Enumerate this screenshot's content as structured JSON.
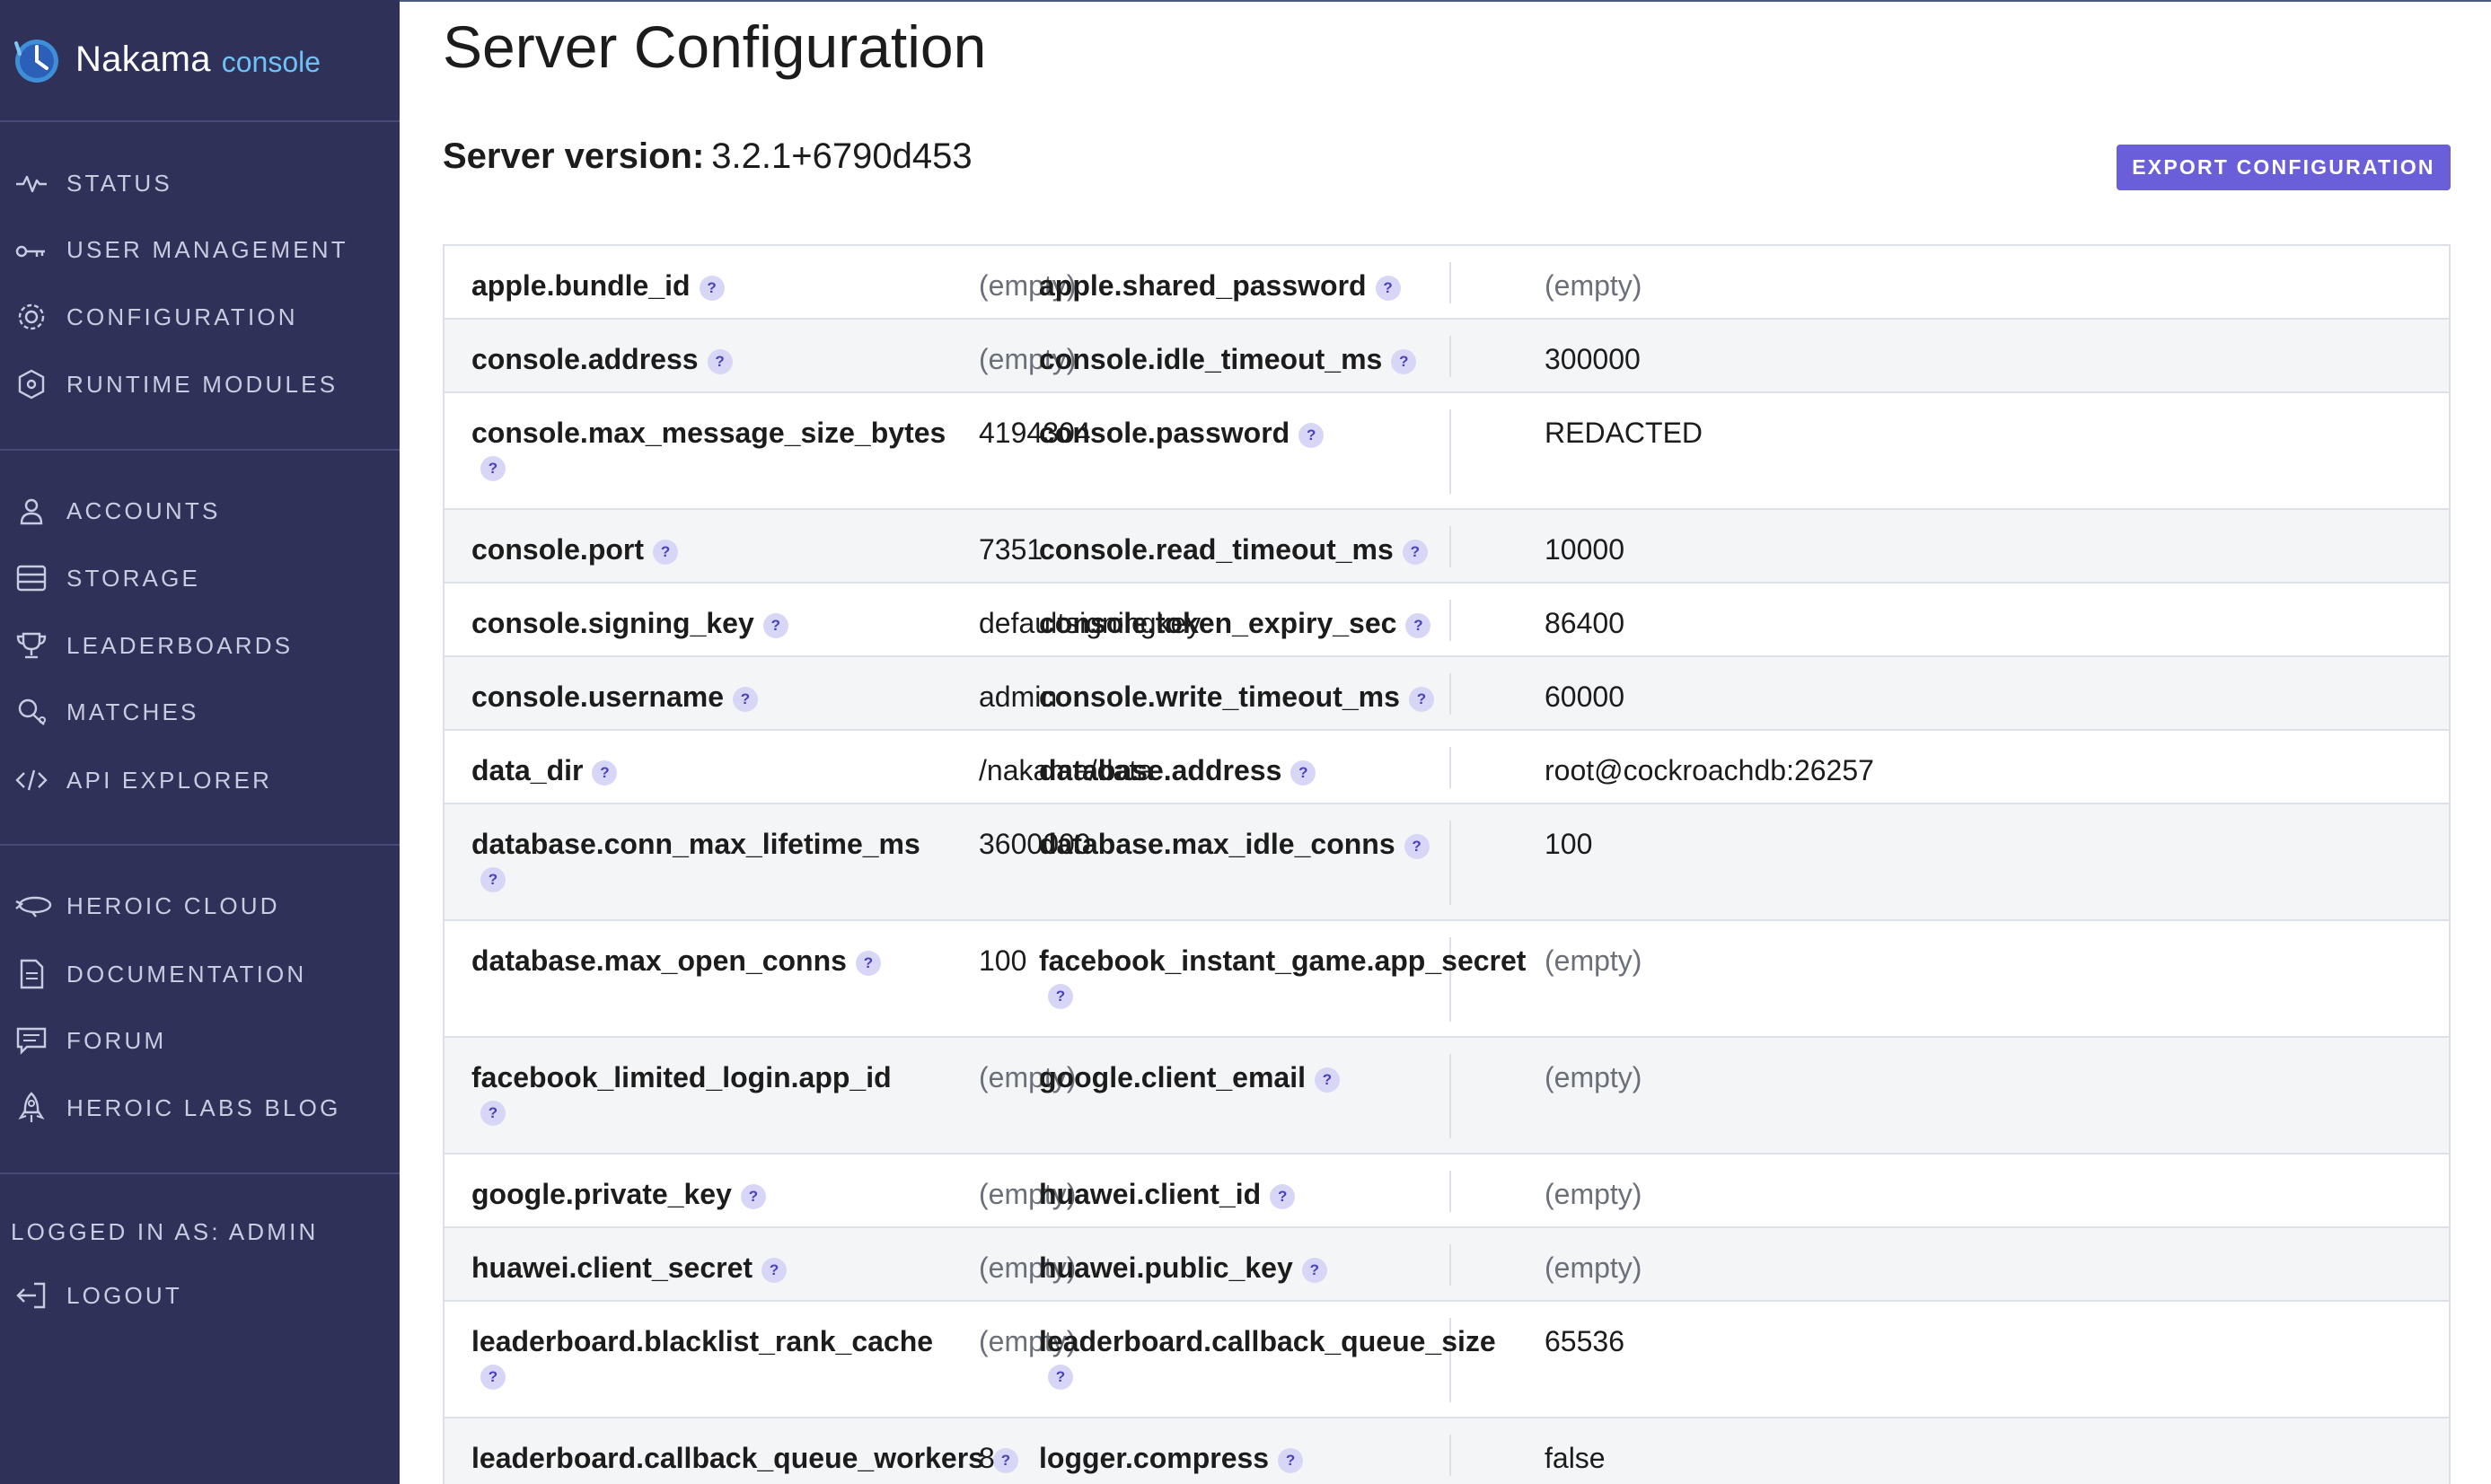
{
  "brand": {
    "name": "Nakama",
    "sub": "console"
  },
  "nav": {
    "status": "STATUS",
    "user_management": "USER MANAGEMENT",
    "configuration": "CONFIGURATION",
    "runtime_modules": "RUNTIME MODULES",
    "accounts": "ACCOUNTS",
    "storage": "STORAGE",
    "leaderboards": "LEADERBOARDS",
    "matches": "MATCHES",
    "api_explorer": "API EXPLORER",
    "heroic_cloud": "HEROIC CLOUD",
    "documentation": "DOCUMENTATION",
    "forum": "FORUM",
    "heroic_labs_blog": "HEROIC LABS BLOG",
    "logged_in": "LOGGED IN AS: ADMIN",
    "logout": "LOGOUT"
  },
  "page": {
    "title": "Server Configuration",
    "version_label": "Server version:",
    "version_value": "3.2.1+6790d453",
    "export_button": "EXPORT CONFIGURATION",
    "help_glyph": "?"
  },
  "config_rows": [
    [
      {
        "key": "apple.bundle_id",
        "value": "(empty)"
      },
      {
        "key": "apple.shared_password",
        "value": "(empty)"
      }
    ],
    [
      {
        "key": "console.address",
        "value": "(empty)"
      },
      {
        "key": "console.idle_timeout_ms",
        "value": "300000"
      }
    ],
    [
      {
        "key": "console.max_message_size_bytes",
        "value": "4194304"
      },
      {
        "key": "console.password",
        "value": "REDACTED"
      }
    ],
    [
      {
        "key": "console.port",
        "value": "7351"
      },
      {
        "key": "console.read_timeout_ms",
        "value": "10000"
      }
    ],
    [
      {
        "key": "console.signing_key",
        "value": "defaultsigningkey"
      },
      {
        "key": "console.token_expiry_sec",
        "value": "86400"
      }
    ],
    [
      {
        "key": "console.username",
        "value": "admin"
      },
      {
        "key": "console.write_timeout_ms",
        "value": "60000"
      }
    ],
    [
      {
        "key": "data_dir",
        "value": "/nakama/data"
      },
      {
        "key": "database.address",
        "value": "root@cockroachdb:26257"
      }
    ],
    [
      {
        "key": "database.conn_max_lifetime_ms",
        "value": "3600000"
      },
      {
        "key": "database.max_idle_conns",
        "value": "100"
      }
    ],
    [
      {
        "key": "database.max_open_conns",
        "value": "100"
      },
      {
        "key": "facebook_instant_game.app_secret",
        "value": "(empty)"
      }
    ],
    [
      {
        "key": "facebook_limited_login.app_id",
        "value": "(empty)"
      },
      {
        "key": "google.client_email",
        "value": "(empty)"
      }
    ],
    [
      {
        "key": "google.private_key",
        "value": "(empty)"
      },
      {
        "key": "huawei.client_id",
        "value": "(empty)"
      }
    ],
    [
      {
        "key": "huawei.client_secret",
        "value": "(empty)"
      },
      {
        "key": "huawei.public_key",
        "value": "(empty)"
      }
    ],
    [
      {
        "key": "leaderboard.blacklist_rank_cache",
        "value": "(empty)"
      },
      {
        "key": "leaderboard.callback_queue_size",
        "value": "65536"
      }
    ],
    [
      {
        "key": "leaderboard.callback_queue_workers",
        "value": "8"
      },
      {
        "key": "logger.compress",
        "value": "false"
      }
    ]
  ],
  "colors": {
    "sidebar_bg": "#2f3159",
    "accent": "#6a5fd8",
    "brand_sub": "#6ec1f5"
  }
}
